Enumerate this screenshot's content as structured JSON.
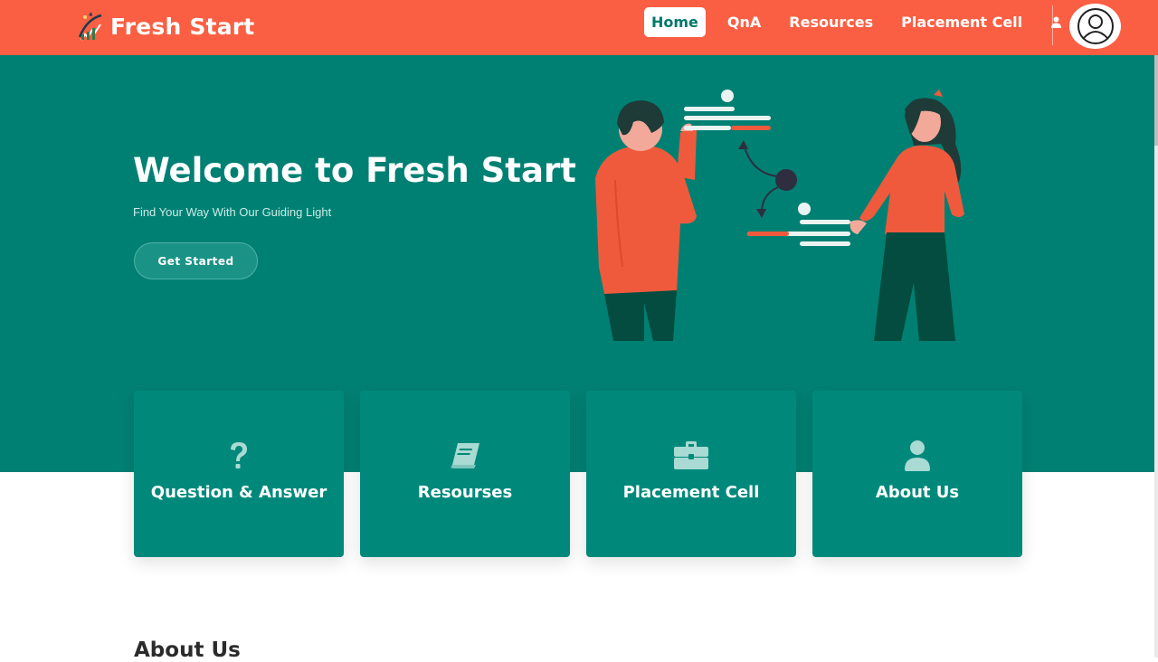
{
  "header": {
    "brand": "Fresh Start",
    "nav": [
      {
        "label": "Home",
        "active": true
      },
      {
        "label": "QnA"
      },
      {
        "label": "Resources"
      },
      {
        "label": "Placement Cell"
      }
    ],
    "icons": {
      "user": "user-icon",
      "avatar": "avatar-icon",
      "logo": "logo-mark"
    }
  },
  "hero": {
    "title": "Welcome to Fresh Start",
    "subtitle": "Find Your Way With Our Guiding Light",
    "cta": "Get Started"
  },
  "cards": [
    {
      "title": "Question & Answer",
      "icon": "question-icon"
    },
    {
      "title": "Resourses",
      "icon": "book-icon"
    },
    {
      "title": "Placement Cell",
      "icon": "briefcase-icon"
    },
    {
      "title": "About Us",
      "icon": "user-icon"
    }
  ],
  "about": {
    "heading": "About Us"
  },
  "colors": {
    "header": "#fa5f43",
    "hero": "#008073",
    "card": "#00897b",
    "accent": "#f05a3c",
    "dark_green": "#054c40",
    "icon_tint": "#a9dad3"
  }
}
